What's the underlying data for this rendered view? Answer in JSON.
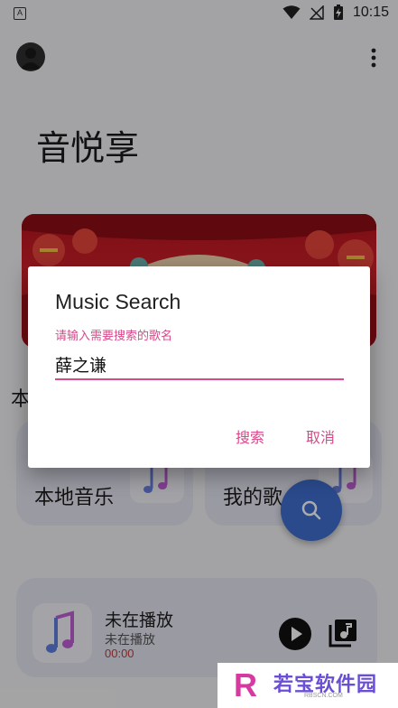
{
  "status_bar": {
    "app_icon_letter": "A",
    "time": "10:15",
    "icons": [
      "wifi-icon",
      "signal-off-icon",
      "battery-charging-icon"
    ]
  },
  "header": {
    "avatar_icon": "user-avatar-icon",
    "menu_icon": "more-vert-icon"
  },
  "app_title": "音悦享",
  "section_initial": "本",
  "cards": [
    {
      "label": "本地音乐",
      "icon": "music-note-icon"
    },
    {
      "label": "我的歌",
      "icon": "music-note-icon"
    }
  ],
  "fab": {
    "icon": "search-icon"
  },
  "player": {
    "title": "未在播放",
    "subtitle": "未在播放",
    "time": "00:00",
    "art_icon": "music-note-icon",
    "play_icon": "play-icon",
    "queue_icon": "playlist-icon"
  },
  "dialog": {
    "title": "Music Search",
    "hint": "请输入需要搜索的歌名",
    "input_value": "薛之谦",
    "search_label": "搜索",
    "cancel_label": "取消",
    "accent": "#d8488a"
  },
  "watermark": {
    "logo_letter": "R",
    "text": "若宝软件园",
    "url": "RBSCN.COM"
  },
  "colors": {
    "accent_pink": "#d8488a",
    "fab_blue": "#3f6fd1",
    "card_bg": "#e6e6f4",
    "banner_red": "#c11721"
  }
}
